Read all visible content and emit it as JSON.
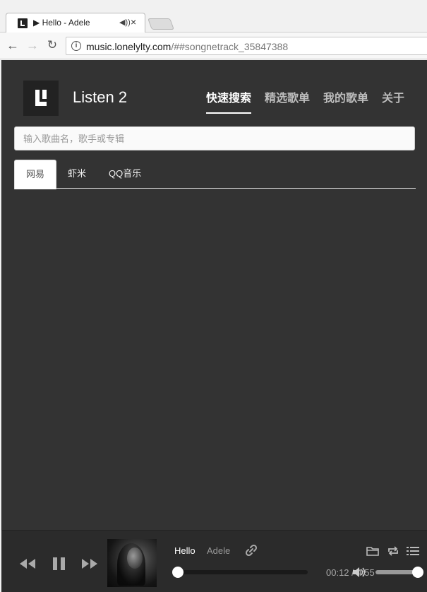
{
  "browser": {
    "tab_title": "▶ Hello - Adele",
    "tab_audio_icon": "speaker-icon",
    "tab_close": "×",
    "url_host": "music.lonelylty.com",
    "url_rest": "/##songnetrack_35847388"
  },
  "app": {
    "brand": "Listen 2",
    "nav": [
      {
        "label": "快速搜索",
        "active": true
      },
      {
        "label": "精选歌单",
        "active": false
      },
      {
        "label": "我的歌单",
        "active": false
      },
      {
        "label": "关于",
        "active": false
      }
    ],
    "search": {
      "placeholder": "输入歌曲名，歌手或专辑",
      "value": ""
    },
    "sources": [
      {
        "label": "网易",
        "active": true
      },
      {
        "label": "虾米",
        "active": false
      },
      {
        "label": "QQ音乐",
        "active": false
      }
    ]
  },
  "player": {
    "song_title": "Hello",
    "song_artist": "Adele",
    "time": "00:12 / 4:55",
    "progress": 0.0,
    "volume": 1.0,
    "icons": {
      "prev": "rewind-icon",
      "pause": "pause-icon",
      "next": "fast-forward-icon",
      "link": "link-icon",
      "volume": "volume-icon",
      "folder": "folder-icon",
      "repeat": "repeat-icon",
      "list": "playlist-icon"
    }
  }
}
